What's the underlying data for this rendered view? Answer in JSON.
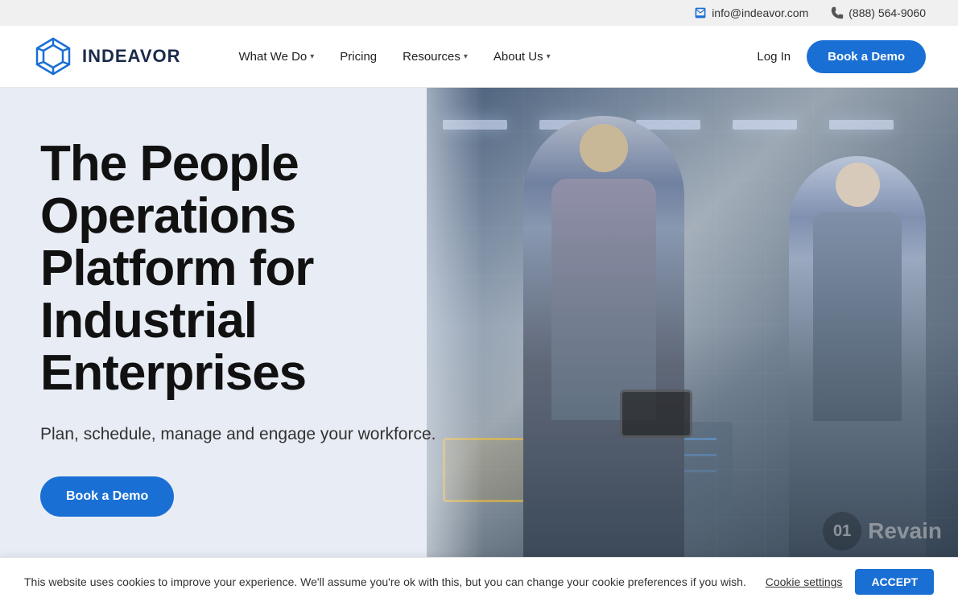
{
  "topbar": {
    "email": "info@indeavor.com",
    "phone": "(888) 564-9060"
  },
  "header": {
    "logo_text": "INDEAVOR",
    "nav": [
      {
        "label": "What We Do",
        "has_dropdown": true
      },
      {
        "label": "Pricing",
        "has_dropdown": false
      },
      {
        "label": "Resources",
        "has_dropdown": true
      },
      {
        "label": "About Us",
        "has_dropdown": true
      }
    ],
    "login_label": "Log In",
    "book_demo_label": "Book a Demo"
  },
  "hero": {
    "title": "The People Operations Platform for Industrial Enterprises",
    "subtitle": "Plan, schedule, manage and engage your workforce.",
    "cta_label": "Book a Demo"
  },
  "cookie": {
    "message": "This website uses cookies to improve your experience. We'll assume you're ok with this, but you can change your cookie preferences if you wish.",
    "settings_label": "Cookie settings",
    "accept_label": "ACCEPT"
  },
  "revain": {
    "circle": "01",
    "text": "Revain"
  }
}
